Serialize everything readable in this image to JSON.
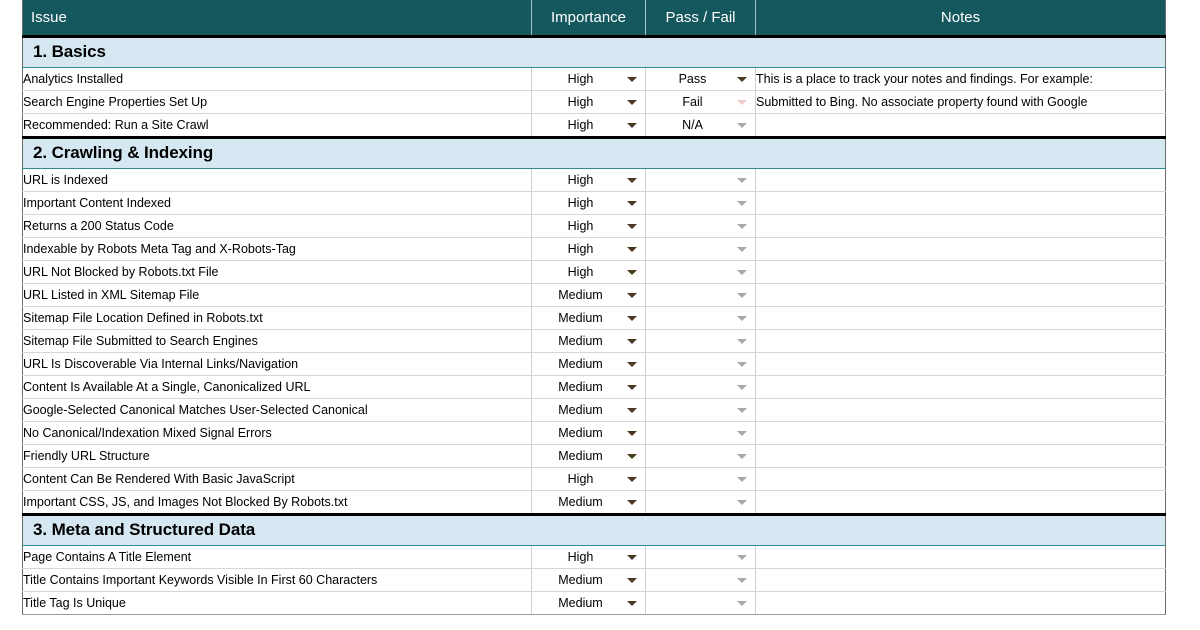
{
  "table": {
    "columns": [
      {
        "key": "issue",
        "label": "Issue",
        "align": "left"
      },
      {
        "key": "importance",
        "label": "Importance",
        "align": "center"
      },
      {
        "key": "passfail",
        "label": "Pass / Fail",
        "align": "center"
      },
      {
        "key": "notes",
        "label": "Notes",
        "align": "center"
      }
    ]
  },
  "colors": {
    "header_bg": "#14585E",
    "header_text": "#FFFFFF",
    "section_bg": "#D5E8F2",
    "high_bg": "#F9B35B",
    "medium_bg": "#FBDBAF",
    "pass_bg": "#B7DFA4",
    "fail_bg": "#A4181F",
    "na_bg": "#F4F4F4",
    "grid_line": "#D6D6D6",
    "section_divider": "#000000"
  },
  "sections": [
    {
      "title": "1. Basics",
      "rows": [
        {
          "issue": "Analytics Installed",
          "importance": "High",
          "importance_level": "high",
          "passfail": "Pass",
          "passfail_level": "pass",
          "notes": "This is a place to track your notes and findings. For example:"
        },
        {
          "issue": "Search Engine Properties Set Up",
          "importance": "High",
          "importance_level": "high",
          "passfail": "Fail",
          "passfail_level": "fail",
          "notes": "Submitted to Bing. No associate property found with Google"
        },
        {
          "issue": "Recommended: Run a Site Crawl",
          "importance": "High",
          "importance_level": "high",
          "passfail": "N/A",
          "passfail_level": "na",
          "notes": ""
        }
      ]
    },
    {
      "title": "2. Crawling & Indexing",
      "rows": [
        {
          "issue": "URL is Indexed",
          "importance": "High",
          "importance_level": "high",
          "passfail": "",
          "passfail_level": "none",
          "notes": ""
        },
        {
          "issue": "Important Content Indexed",
          "importance": "High",
          "importance_level": "high",
          "passfail": "",
          "passfail_level": "none",
          "notes": ""
        },
        {
          "issue": "Returns a 200 Status Code",
          "importance": "High",
          "importance_level": "high",
          "passfail": "",
          "passfail_level": "none",
          "notes": ""
        },
        {
          "issue": "Indexable by Robots Meta Tag and X-Robots-Tag",
          "importance": "High",
          "importance_level": "high",
          "passfail": "",
          "passfail_level": "none",
          "notes": ""
        },
        {
          "issue": "URL Not Blocked by Robots.txt File",
          "importance": "High",
          "importance_level": "high",
          "passfail": "",
          "passfail_level": "none",
          "notes": ""
        },
        {
          "issue": "URL Listed in XML Sitemap File",
          "importance": "Medium",
          "importance_level": "medium",
          "passfail": "",
          "passfail_level": "none",
          "notes": ""
        },
        {
          "issue": "Sitemap File Location Defined in Robots.txt",
          "importance": "Medium",
          "importance_level": "medium",
          "passfail": "",
          "passfail_level": "none",
          "notes": ""
        },
        {
          "issue": "Sitemap File Submitted to Search Engines",
          "importance": "Medium",
          "importance_level": "medium",
          "passfail": "",
          "passfail_level": "none",
          "notes": ""
        },
        {
          "issue": "URL Is Discoverable Via Internal Links/Navigation",
          "importance": "Medium",
          "importance_level": "medium",
          "passfail": "",
          "passfail_level": "none",
          "notes": ""
        },
        {
          "issue": "Content Is Available At a Single, Canonicalized URL",
          "importance": "Medium",
          "importance_level": "medium",
          "passfail": "",
          "passfail_level": "none",
          "notes": ""
        },
        {
          "issue": "Google-Selected Canonical Matches User-Selected Canonical",
          "importance": "Medium",
          "importance_level": "medium",
          "passfail": "",
          "passfail_level": "none",
          "notes": ""
        },
        {
          "issue": "No Canonical/Indexation Mixed Signal Errors",
          "importance": "Medium",
          "importance_level": "medium",
          "passfail": "",
          "passfail_level": "none",
          "notes": ""
        },
        {
          "issue": "Friendly URL Structure",
          "importance": "Medium",
          "importance_level": "medium",
          "passfail": "",
          "passfail_level": "none",
          "notes": ""
        },
        {
          "issue": "Content Can Be Rendered With Basic JavaScript",
          "importance": "High",
          "importance_level": "high",
          "passfail": "",
          "passfail_level": "none",
          "notes": ""
        },
        {
          "issue": "Important CSS, JS, and Images Not Blocked By Robots.txt",
          "importance": "Medium",
          "importance_level": "medium",
          "passfail": "",
          "passfail_level": "none",
          "notes": ""
        }
      ]
    },
    {
      "title": "3. Meta and Structured Data",
      "rows": [
        {
          "issue": "Page Contains A Title Element",
          "importance": "High",
          "importance_level": "high",
          "passfail": "",
          "passfail_level": "none",
          "notes": ""
        },
        {
          "issue": "Title Contains Important Keywords Visible In First 60 Characters",
          "importance": "Medium",
          "importance_level": "medium",
          "passfail": "",
          "passfail_level": "none",
          "notes": ""
        },
        {
          "issue": "Title Tag Is Unique",
          "importance": "Medium",
          "importance_level": "medium",
          "passfail": "",
          "passfail_level": "none",
          "notes": ""
        }
      ]
    }
  ]
}
